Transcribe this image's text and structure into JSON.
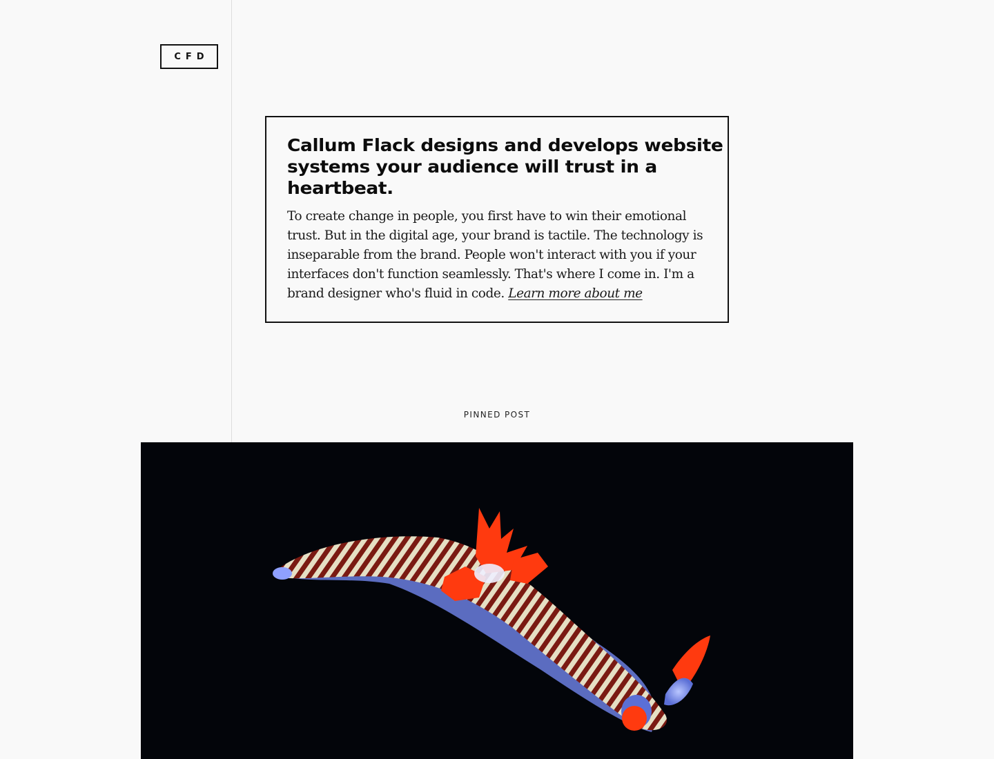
{
  "logo": {
    "text": "CFD"
  },
  "intro": {
    "title": "Callum Flack designs and develops website systems your audience will trust in a heartbeat.",
    "body": "To create change in people, you first have to win their emotional trust. But in the digital age, your brand is tactile. The technology is inseparable from the brand. People won't interact with you if your interfaces don't function seamlessly. That's where I come in. I'm a brand designer who's fluid in code.",
    "link_label": "Learn more about me"
  },
  "pinned": {
    "label": "PINNED POST",
    "image": {
      "subject": "nudibranch",
      "background_color": "#03050a",
      "accent_colors": [
        "#ff3a0f",
        "#6b7fe0",
        "#7a1a12",
        "#e8e6c8"
      ]
    }
  }
}
